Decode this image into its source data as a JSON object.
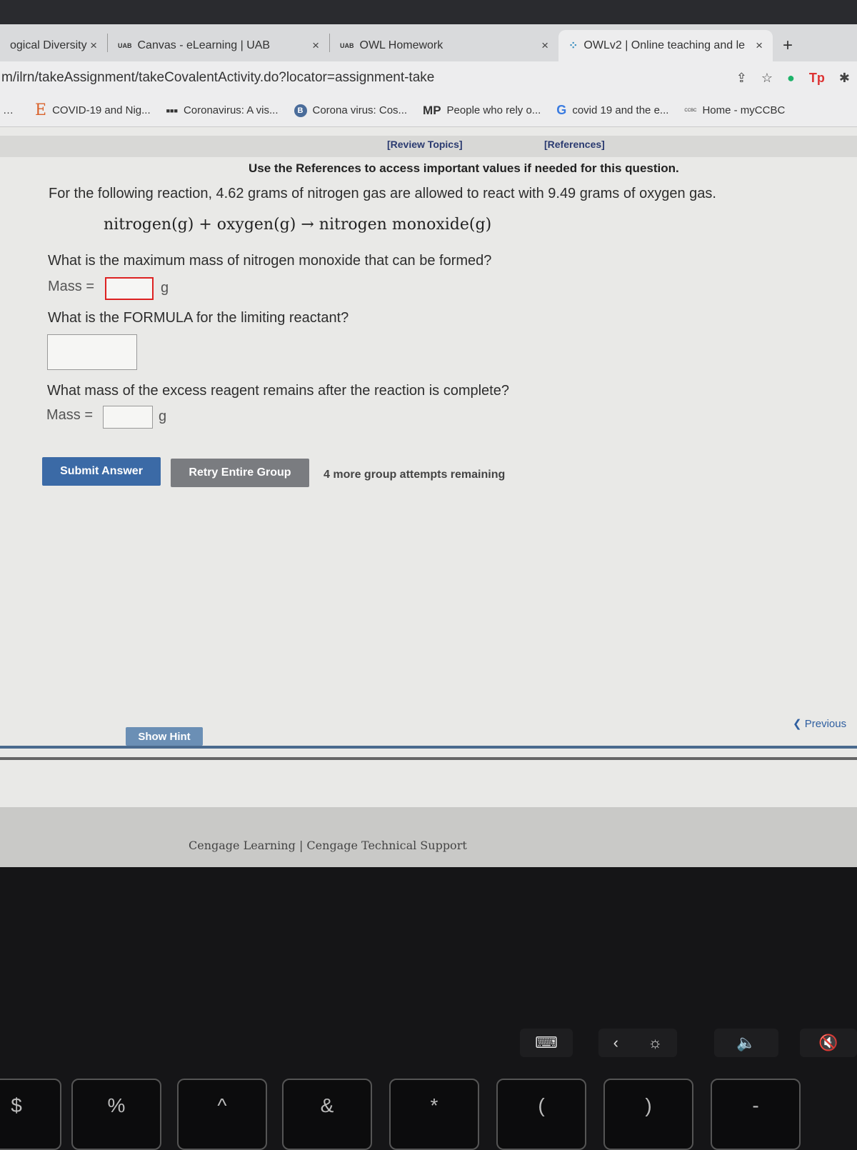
{
  "browser": {
    "tabs": [
      {
        "label": "ogical Diversity",
        "close": "×"
      },
      {
        "favicon": "UAB",
        "label": "Canvas - eLearning | UAB",
        "close": "×"
      },
      {
        "favicon": "UAB",
        "label": "OWL Homework",
        "close": "×"
      },
      {
        "favicon": "owl-spinner-icon",
        "label": "OWLv2 | Online teaching and le",
        "close": "×",
        "active": true
      }
    ],
    "new_tab": "+",
    "url": "m/ilrn/takeAssignment/takeCovalentActivity.do?locator=assignment-take",
    "extensions": [
      "share-icon",
      "star-icon",
      "grammarly-icon",
      "Tp",
      "puzzle-icon"
    ],
    "bookmarks": [
      {
        "icon": "E",
        "label": "COVID-19 and Nig..."
      },
      {
        "icon": "■■■",
        "label": "Coronavirus: A vis..."
      },
      {
        "icon": "B",
        "label": "Corona virus: Cos..."
      },
      {
        "icon": "MP",
        "label": "People who rely o..."
      },
      {
        "icon": "G",
        "label": "covid 19 and the e..."
      },
      {
        "icon": "CCBC",
        "label": "Home - myCCBC"
      }
    ]
  },
  "question": {
    "review_topics": "[Review Topics]",
    "references": "[References]",
    "note": "Use the References to access important values if needed for this question.",
    "prompt": "For the following reaction, 4.62 grams of nitrogen gas are allowed to react with 9.49 grams of oxygen gas.",
    "equation": "nitrogen(g) + oxygen(g) → nitrogen monoxide(g)",
    "q1": "What is the maximum mass of nitrogen monoxide that can be formed?",
    "mass_label": "Mass =",
    "unit": "g",
    "q2": "What is the FORMULA for the limiting reactant?",
    "q3": "What mass of the excess reagent remains after the reaction is complete?",
    "answers": {
      "mass1": "",
      "formula": "",
      "mass2": ""
    }
  },
  "actions": {
    "submit": "Submit Answer",
    "retry": "Retry Entire Group",
    "attempts": "4 more group attempts remaining",
    "show_hint": "Show Hint",
    "previous": "Previous"
  },
  "footer": {
    "cengage": "Cengage Learning",
    "separator": "|",
    "support": "Cengage Technical Support"
  },
  "keyboard": {
    "keys": [
      "$",
      "%",
      "^",
      "&",
      "*",
      "(",
      ")",
      "-"
    ],
    "touchbar": [
      "keyboard-icon",
      "chevron-left-icon",
      "brightness-icon",
      "volume-icon",
      "mute-icon"
    ]
  }
}
